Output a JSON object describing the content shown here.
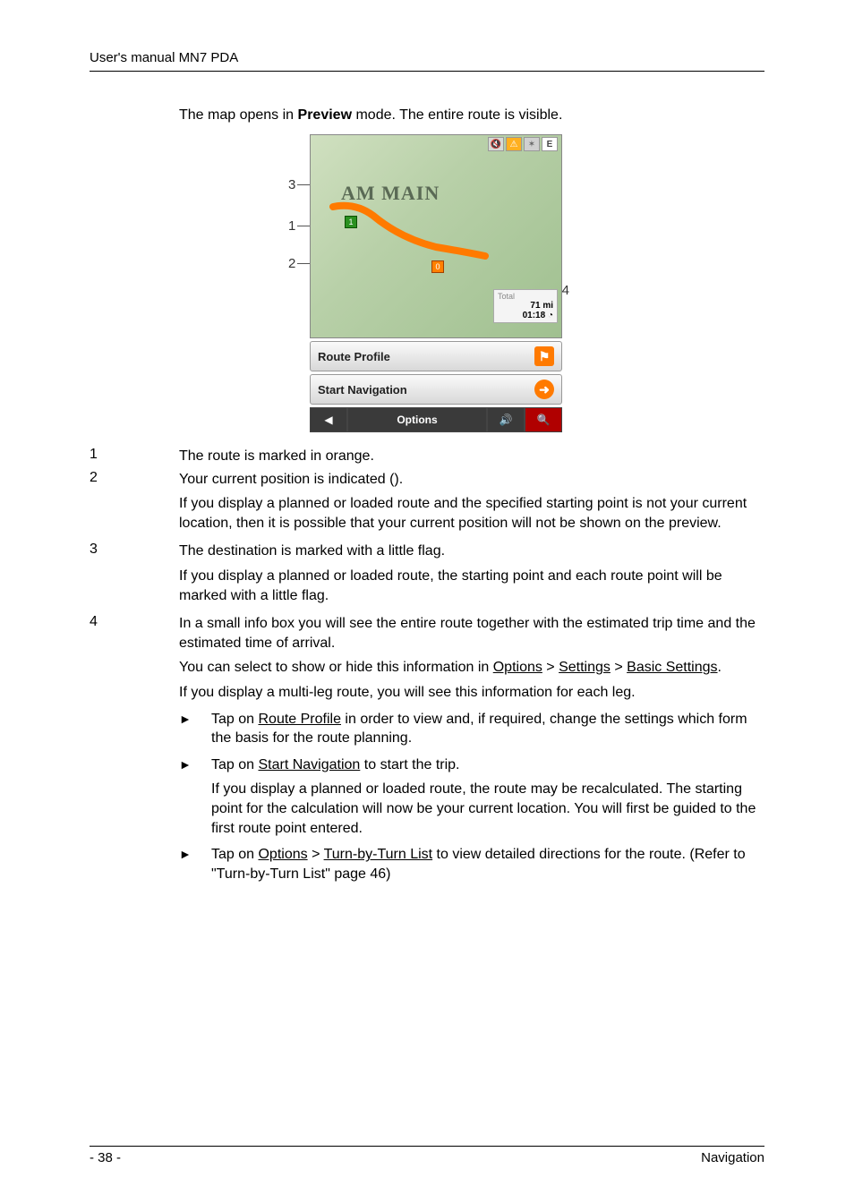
{
  "header": {
    "title": "User's manual MN7 PDA"
  },
  "intro": {
    "pre": "The map opens in ",
    "bold": "Preview",
    "post": " mode. The entire route is visible."
  },
  "screenshot": {
    "map_label": "AM MAIN",
    "top_icons": {
      "e": "E"
    },
    "flags": {
      "start": "1",
      "dest": "0"
    },
    "infobox": {
      "label": "Total",
      "distance": "71",
      "distance_unit": "mi",
      "time": "01:18"
    },
    "buttons": {
      "route_profile": "Route Profile",
      "start_nav": "Start Navigation",
      "options": "Options"
    },
    "annotations": {
      "a1": "1",
      "a2": "2",
      "a3": "3",
      "a4": "4"
    }
  },
  "items": {
    "i1": {
      "num": "1",
      "text": "The route is marked in orange."
    },
    "i2": {
      "num": "2",
      "text": "Your current position is indicated ().",
      "para": "If you display a planned or loaded route and the specified starting point is not your current location, then it is possible that your current position will not be shown on the preview."
    },
    "i3": {
      "num": "3",
      "text": "The destination is marked with a little flag.",
      "para": "If you display a planned or loaded route, the starting point and each route point will be marked with a little flag."
    },
    "i4": {
      "num": "4",
      "text": "In a small info box you will see the entire route together with the estimated trip time and the estimated time of arrival.",
      "para1_pre": "You can select to show or hide this information in ",
      "para1_u1": "Options",
      "para1_mid1": " > ",
      "para1_u2": "Settings",
      "para1_mid2": " > ",
      "para1_u3": "Basic Settings",
      "para1_post": ".",
      "para2": "If you display a multi-leg route, you will see this information for each leg."
    }
  },
  "bullets": {
    "b1": {
      "pre": "Tap on ",
      "u": "Route Profile",
      "post": " in order to view and, if required, change the settings which form the basis for the route planning."
    },
    "b2": {
      "pre": "Tap on ",
      "u": "Start Navigation",
      "post": " to start the trip.",
      "sub": "If you display a planned or loaded route, the route may be recalculated. The starting point for the calculation will now be your current location. You will first be guided to the first route point entered."
    },
    "b3": {
      "pre": "Tap on ",
      "u1": "Options",
      "mid": " > ",
      "u2": "Turn-by-Turn List",
      "post": " to view detailed directions for the route. (Refer to \"Turn-by-Turn List\" page 46)"
    }
  },
  "footer": {
    "page": "- 38 -",
    "section": "Navigation"
  }
}
